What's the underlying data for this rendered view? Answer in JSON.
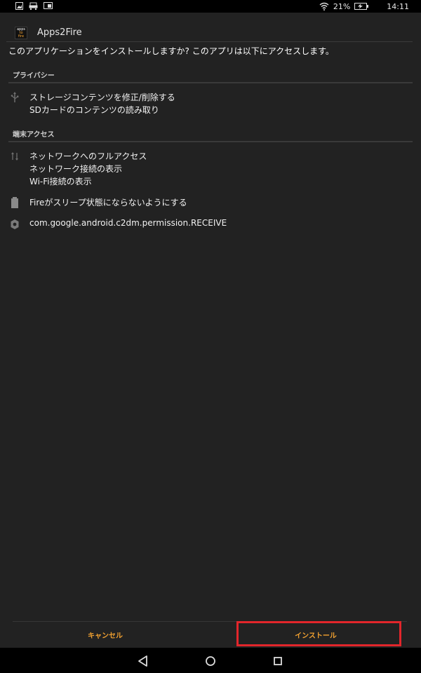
{
  "status_bar": {
    "left_icons": [
      "image-icon",
      "car-icon",
      "cast-icon"
    ],
    "battery_percent": "21%",
    "time": "14:11"
  },
  "app": {
    "logo_lines": [
      "apps",
      "to",
      "fire"
    ],
    "name": "Apps2Fire"
  },
  "prompt": "このアプリケーションをインストールしますか? このアプリは以下にアクセスします。",
  "sections": [
    {
      "title": "プライバシー",
      "groups": [
        {
          "icon": "usb-icon",
          "lines": [
            "ストレージコンテンツを修正/削除する",
            "SDカードのコンテンツの読み取り"
          ]
        }
      ]
    },
    {
      "title": "端末アクセス",
      "groups": [
        {
          "icon": "network-arrows-icon",
          "lines": [
            "ネットワークへのフルアクセス",
            "ネットワーク接続の表示",
            "Wi-Fi接続の表示"
          ]
        },
        {
          "icon": "battery-icon",
          "lines": [
            "Fireがスリープ状態にならないようにする"
          ]
        },
        {
          "icon": "gear-icon",
          "lines": [
            "com.google.android.c2dm.permission.RECEIVE"
          ]
        }
      ]
    }
  ],
  "buttons": {
    "cancel": "キャンセル",
    "install": "インストール"
  },
  "nav": [
    "back-icon",
    "home-icon",
    "recents-icon"
  ],
  "colors": {
    "background": "#222222",
    "accent": "#f0a030",
    "highlight": "#e2262b"
  }
}
